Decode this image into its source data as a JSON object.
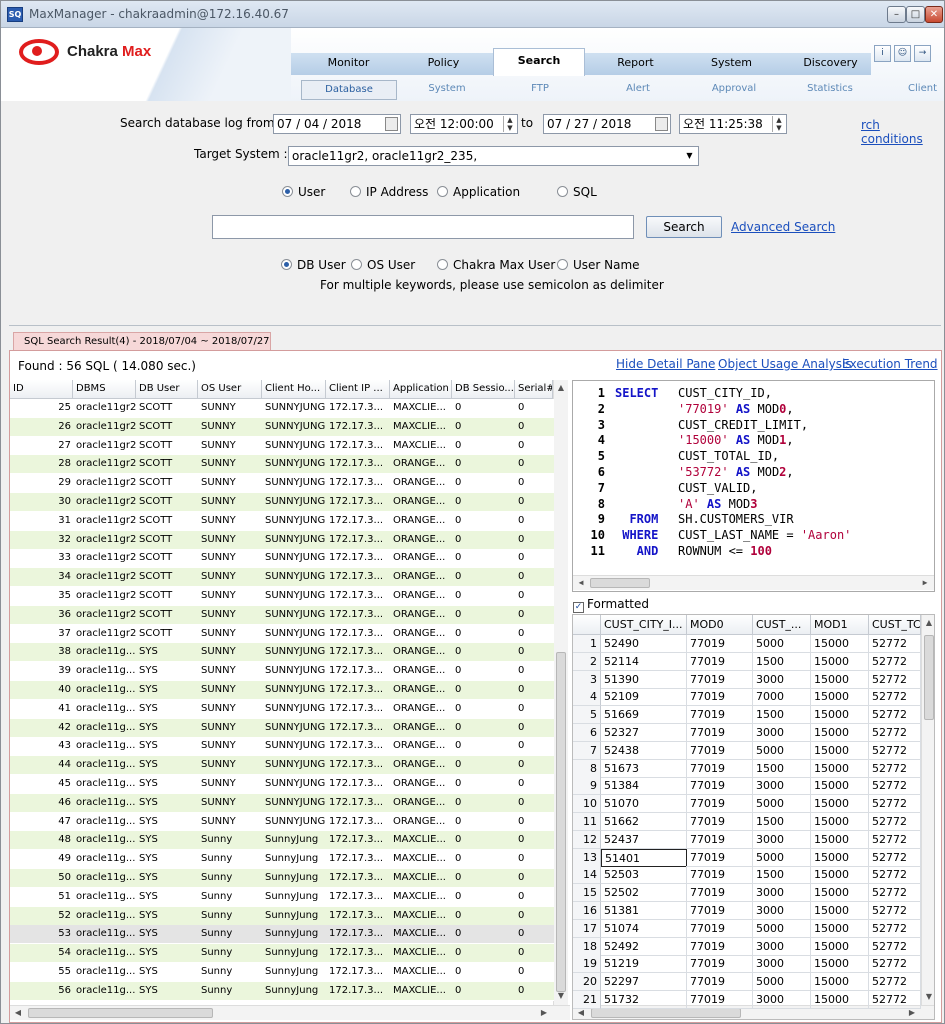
{
  "window": {
    "title": "MaxManager - chakraadmin@172.16.40.67"
  },
  "logo": {
    "name1": "Chakra",
    "name2": " Max"
  },
  "top_tabs": [
    "Monitor",
    "Policy",
    "Search",
    "Report",
    "System",
    "Discovery"
  ],
  "sub_tabs": [
    "Database",
    "System",
    "FTP",
    "Alert",
    "Approval",
    "Statistics",
    "Client"
  ],
  "search_form": {
    "from_label": "Search database log from",
    "from_date": "07 / 04 / 2018",
    "from_time": "오전 12:00:00",
    "to_label": "to",
    "to_date": "07 / 27 / 2018",
    "to_time": "오전 11:25:38",
    "conditions_link": "rch conditions",
    "target_label": "Target System :",
    "target_value": "oracle11gr2, oracle11gr2_235,",
    "type_radios": [
      "User",
      "IP Address",
      "Application",
      "SQL"
    ],
    "keyword_value": "",
    "search_button": "Search",
    "advanced_link": "Advanced Search",
    "user_radios": [
      "DB User",
      "OS User",
      "Chakra Max User",
      "User Name"
    ],
    "hint": "For multiple keywords, please use semicolon as delimiter"
  },
  "result_tab": "SQL Search Result(4) - 2018/07/04 ~ 2018/07/27",
  "found": "Found  : 56 SQL ( 14.080 sec.)",
  "links": {
    "hide": "Hide Detail Pane",
    "usage": "Object Usage Analysis",
    "trend": "Execution Trend"
  },
  "grid": {
    "headers": [
      "ID",
      "DBMS",
      "DB User",
      "OS User",
      "Client Ho...",
      "Client IP ...",
      "Application",
      "DB Sessio...",
      "Serial#"
    ],
    "rows": [
      [
        "25",
        "oracle11gr2",
        "SCOTT",
        "SUNNY",
        "SUNNYJUNG",
        "172.17.3...",
        "MAXCLIE...",
        "0",
        "0"
      ],
      [
        "26",
        "oracle11gr2",
        "SCOTT",
        "SUNNY",
        "SUNNYJUNG",
        "172.17.3...",
        "MAXCLIE...",
        "0",
        "0"
      ],
      [
        "27",
        "oracle11gr2",
        "SCOTT",
        "SUNNY",
        "SUNNYJUNG",
        "172.17.3...",
        "MAXCLIE...",
        "0",
        "0"
      ],
      [
        "28",
        "oracle11gr2",
        "SCOTT",
        "SUNNY",
        "SUNNYJUNG",
        "172.17.3...",
        "ORANGE...",
        "0",
        "0"
      ],
      [
        "29",
        "oracle11gr2",
        "SCOTT",
        "SUNNY",
        "SUNNYJUNG",
        "172.17.3...",
        "ORANGE...",
        "0",
        "0"
      ],
      [
        "30",
        "oracle11gr2",
        "SCOTT",
        "SUNNY",
        "SUNNYJUNG",
        "172.17.3...",
        "ORANGE...",
        "0",
        "0"
      ],
      [
        "31",
        "oracle11gr2",
        "SCOTT",
        "SUNNY",
        "SUNNYJUNG",
        "172.17.3...",
        "ORANGE...",
        "0",
        "0"
      ],
      [
        "32",
        "oracle11gr2",
        "SCOTT",
        "SUNNY",
        "SUNNYJUNG",
        "172.17.3...",
        "ORANGE...",
        "0",
        "0"
      ],
      [
        "33",
        "oracle11gr2",
        "SCOTT",
        "SUNNY",
        "SUNNYJUNG",
        "172.17.3...",
        "ORANGE...",
        "0",
        "0"
      ],
      [
        "34",
        "oracle11gr2",
        "SCOTT",
        "SUNNY",
        "SUNNYJUNG",
        "172.17.3...",
        "ORANGE...",
        "0",
        "0"
      ],
      [
        "35",
        "oracle11gr2",
        "SCOTT",
        "SUNNY",
        "SUNNYJUNG",
        "172.17.3...",
        "ORANGE...",
        "0",
        "0"
      ],
      [
        "36",
        "oracle11gr2",
        "SCOTT",
        "SUNNY",
        "SUNNYJUNG",
        "172.17.3...",
        "ORANGE...",
        "0",
        "0"
      ],
      [
        "37",
        "oracle11gr2",
        "SCOTT",
        "SUNNY",
        "SUNNYJUNG",
        "172.17.3...",
        "ORANGE...",
        "0",
        "0"
      ],
      [
        "38",
        "oracle11g...",
        "SYS",
        "SUNNY",
        "SUNNYJUNG",
        "172.17.3...",
        "ORANGE...",
        "0",
        "0"
      ],
      [
        "39",
        "oracle11g...",
        "SYS",
        "SUNNY",
        "SUNNYJUNG",
        "172.17.3...",
        "ORANGE...",
        "0",
        "0"
      ],
      [
        "40",
        "oracle11g...",
        "SYS",
        "SUNNY",
        "SUNNYJUNG",
        "172.17.3...",
        "ORANGE...",
        "0",
        "0"
      ],
      [
        "41",
        "oracle11g...",
        "SYS",
        "SUNNY",
        "SUNNYJUNG",
        "172.17.3...",
        "ORANGE...",
        "0",
        "0"
      ],
      [
        "42",
        "oracle11g...",
        "SYS",
        "SUNNY",
        "SUNNYJUNG",
        "172.17.3...",
        "ORANGE...",
        "0",
        "0"
      ],
      [
        "43",
        "oracle11g...",
        "SYS",
        "SUNNY",
        "SUNNYJUNG",
        "172.17.3...",
        "ORANGE...",
        "0",
        "0"
      ],
      [
        "44",
        "oracle11g...",
        "SYS",
        "SUNNY",
        "SUNNYJUNG",
        "172.17.3...",
        "ORANGE...",
        "0",
        "0"
      ],
      [
        "45",
        "oracle11g...",
        "SYS",
        "SUNNY",
        "SUNNYJUNG",
        "172.17.3...",
        "ORANGE...",
        "0",
        "0"
      ],
      [
        "46",
        "oracle11g...",
        "SYS",
        "SUNNY",
        "SUNNYJUNG",
        "172.17.3...",
        "ORANGE...",
        "0",
        "0"
      ],
      [
        "47",
        "oracle11g...",
        "SYS",
        "SUNNY",
        "SUNNYJUNG",
        "172.17.3...",
        "ORANGE...",
        "0",
        "0"
      ],
      [
        "48",
        "oracle11g...",
        "SYS",
        "Sunny",
        "SunnyJung",
        "172.17.3...",
        "MAXCLIE...",
        "0",
        "0"
      ],
      [
        "49",
        "oracle11g...",
        "SYS",
        "Sunny",
        "SunnyJung",
        "172.17.3...",
        "MAXCLIE...",
        "0",
        "0"
      ],
      [
        "50",
        "oracle11g...",
        "SYS",
        "Sunny",
        "SunnyJung",
        "172.17.3...",
        "MAXCLIE...",
        "0",
        "0"
      ],
      [
        "51",
        "oracle11g...",
        "SYS",
        "Sunny",
        "SunnyJung",
        "172.17.3...",
        "MAXCLIE...",
        "0",
        "0"
      ],
      [
        "52",
        "oracle11g...",
        "SYS",
        "Sunny",
        "SunnyJung",
        "172.17.3...",
        "MAXCLIE...",
        "0",
        "0"
      ],
      [
        "53",
        "oracle11g...",
        "SYS",
        "Sunny",
        "SunnyJung",
        "172.17.3...",
        "MAXCLIE...",
        "0",
        "0"
      ],
      [
        "54",
        "oracle11g...",
        "SYS",
        "Sunny",
        "SunnyJung",
        "172.17.3...",
        "MAXCLIE...",
        "0",
        "0"
      ],
      [
        "55",
        "oracle11g...",
        "SYS",
        "Sunny",
        "SunnyJung",
        "172.17.3...",
        "MAXCLIE...",
        "0",
        "0"
      ],
      [
        "56",
        "oracle11g...",
        "SYS",
        "Sunny",
        "SunnyJung",
        "172.17.3...",
        "MAXCLIE...",
        "0",
        "0"
      ]
    ]
  },
  "sql": [
    [
      "1",
      "SELECT ",
      "CUST_CITY_ID,"
    ],
    [
      "2",
      "       ",
      "'77019' AS MOD0,"
    ],
    [
      "3",
      "       ",
      "CUST_CREDIT_LIMIT,"
    ],
    [
      "4",
      "       ",
      "'15000' AS MOD1,"
    ],
    [
      "5",
      "       ",
      "CUST_TOTAL_ID,"
    ],
    [
      "6",
      "       ",
      "'53772' AS MOD2,"
    ],
    [
      "7",
      "       ",
      "CUST_VALID,"
    ],
    [
      "8",
      "       ",
      "'A' AS MOD3"
    ],
    [
      "9",
      "  FROM ",
      "SH.CUSTOMERS_VIR"
    ],
    [
      "10",
      " WHERE ",
      "CUST_LAST_NAME = 'Aaron'"
    ],
    [
      "11",
      "   AND ",
      "ROWNUM <= 100"
    ]
  ],
  "formatted_label": "Formatted",
  "result": {
    "headers": [
      "CUST_CITY_I...",
      "MOD0",
      "CUST_...",
      "MOD1",
      "CUST_TC"
    ],
    "rows": [
      [
        "1",
        "52490",
        "77019",
        "5000",
        "15000",
        "52772"
      ],
      [
        "2",
        "52114",
        "77019",
        "1500",
        "15000",
        "52772"
      ],
      [
        "3",
        "51390",
        "77019",
        "3000",
        "15000",
        "52772"
      ],
      [
        "4",
        "52109",
        "77019",
        "7000",
        "15000",
        "52772"
      ],
      [
        "5",
        "51669",
        "77019",
        "1500",
        "15000",
        "52772"
      ],
      [
        "6",
        "52327",
        "77019",
        "3000",
        "15000",
        "52772"
      ],
      [
        "7",
        "52438",
        "77019",
        "5000",
        "15000",
        "52772"
      ],
      [
        "8",
        "51673",
        "77019",
        "1500",
        "15000",
        "52772"
      ],
      [
        "9",
        "51384",
        "77019",
        "3000",
        "15000",
        "52772"
      ],
      [
        "10",
        "51070",
        "77019",
        "5000",
        "15000",
        "52772"
      ],
      [
        "11",
        "51662",
        "77019",
        "1500",
        "15000",
        "52772"
      ],
      [
        "12",
        "52437",
        "77019",
        "3000",
        "15000",
        "52772"
      ],
      [
        "13",
        "51401",
        "77019",
        "5000",
        "15000",
        "52772"
      ],
      [
        "14",
        "52503",
        "77019",
        "1500",
        "15000",
        "52772"
      ],
      [
        "15",
        "52502",
        "77019",
        "3000",
        "15000",
        "52772"
      ],
      [
        "16",
        "51381",
        "77019",
        "3000",
        "15000",
        "52772"
      ],
      [
        "17",
        "51074",
        "77019",
        "5000",
        "15000",
        "52772"
      ],
      [
        "18",
        "52492",
        "77019",
        "3000",
        "15000",
        "52772"
      ],
      [
        "19",
        "51219",
        "77019",
        "3000",
        "15000",
        "52772"
      ],
      [
        "20",
        "52297",
        "77019",
        "5000",
        "15000",
        "52772"
      ],
      [
        "21",
        "51732",
        "77019",
        "3000",
        "15000",
        "52772"
      ]
    ]
  }
}
